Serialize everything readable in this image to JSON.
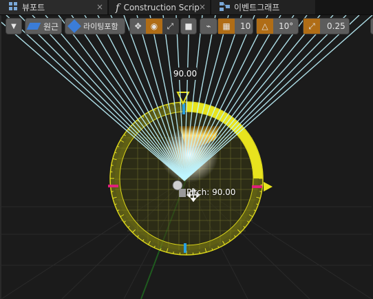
{
  "tabs": [
    {
      "label": "뷰포트",
      "close": "×",
      "icon": "viewport-grid-icon"
    },
    {
      "label": "Construction Scrip",
      "close": "×",
      "icon": "function-icon",
      "icon_text": "f"
    },
    {
      "label": "이벤트그래프",
      "close": "",
      "icon": "event-graph-icon"
    }
  ],
  "toolbar": {
    "dropdown_icon": "chevron-down-icon",
    "perspective": "원근",
    "lighting": "라이팅포함",
    "grid_snap_value": "10",
    "rotation_snap_value": "10°",
    "scale_snap_value": "0.25"
  },
  "gizmo": {
    "angle_label": "90.00",
    "pitch_label": "Pitch: 90.00",
    "ring_color": "#e8e31e",
    "ray_color": "#bff5ff"
  }
}
